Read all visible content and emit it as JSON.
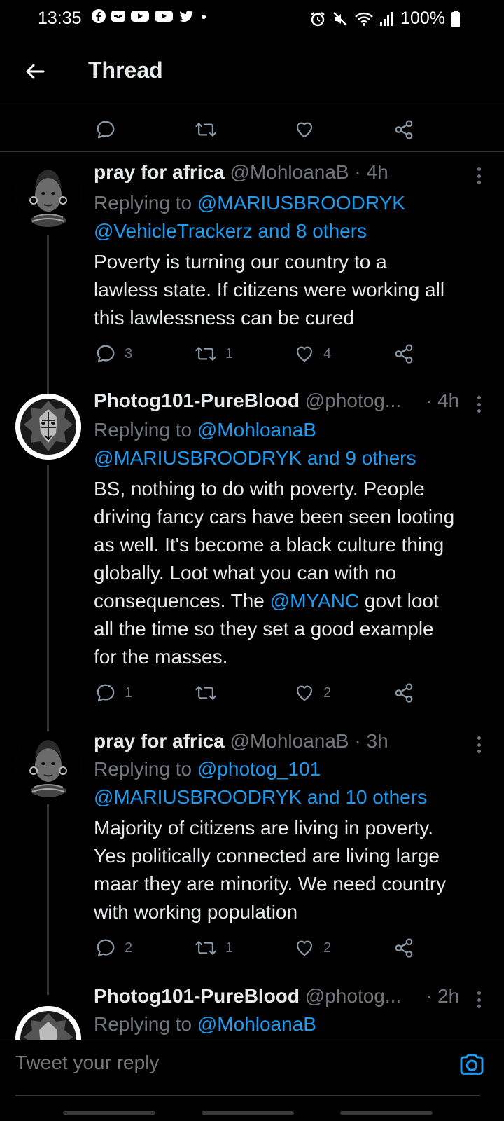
{
  "status_bar": {
    "time": "13:35",
    "app_icons": [
      "facebook-icon",
      "inbox-icon",
      "youtube-icon",
      "youtube-icon",
      "twitter-icon"
    ],
    "battery": "100%"
  },
  "header": {
    "title": "Thread"
  },
  "top_actions": {
    "reply_count": "",
    "retweet_count": "",
    "like_count": ""
  },
  "tweets": [
    {
      "name": "pray for africa",
      "handle": "@MohloanaB",
      "time": "· 4h",
      "replying_prefix": "Replying to",
      "replying_mentions_line1": "@MARIUSBROODRYK",
      "replying_mentions_line2": "@VehicleTrackerz and 8 others",
      "text_lines": [
        "Poverty is turning our country to a",
        "lawless state. If citizens were working all",
        "this lawlessness can be cured"
      ],
      "reply_count": "3",
      "retweet_count": "1",
      "like_count": "4"
    },
    {
      "name": "Photog101-PureBlood",
      "handle": "@photog...",
      "time": "· 4h",
      "replying_prefix": "Replying to",
      "replying_mentions_line1": "@MohloanaB",
      "replying_mentions_line2": "@MARIUSBROODRYK and 9 others",
      "text_lines": [
        "BS, nothing to do with poverty. People",
        "driving fancy cars have been seen looting",
        "as well. It's become a black culture thing",
        "globally. Loot what you can with no"
      ],
      "text_line5_before": "consequences. The ",
      "text_line5_mention": "@MYANC",
      "text_line5_after": " govt loot",
      "text_lines_end": [
        "all the time so they set a good example",
        "for the masses."
      ],
      "reply_count": "1",
      "retweet_count": "",
      "like_count": "2"
    },
    {
      "name": "pray for africa",
      "handle": "@MohloanaB",
      "time": "· 3h",
      "replying_prefix": "Replying to",
      "replying_mentions_line1": "@photog_101",
      "replying_mentions_line2": "@MARIUSBROODRYK and 10 others",
      "text_lines": [
        "Majority of citizens are living in poverty.",
        "Yes politically connected are living large",
        "maar they are minority. We need country",
        "with working population"
      ],
      "reply_count": "2",
      "retweet_count": "1",
      "like_count": "2"
    },
    {
      "name": "Photog101-PureBlood",
      "handle": "@photog...",
      "time": "· 2h",
      "replying_prefix": "Replying to",
      "replying_mentions_line1": "@MohloanaB"
    }
  ],
  "composer": {
    "placeholder": "Tweet your reply"
  },
  "colors": {
    "background": "#000000",
    "text": "#e7e9ea",
    "muted": "#71767b",
    "link": "#1d9bf0",
    "divider": "#2f3336"
  }
}
